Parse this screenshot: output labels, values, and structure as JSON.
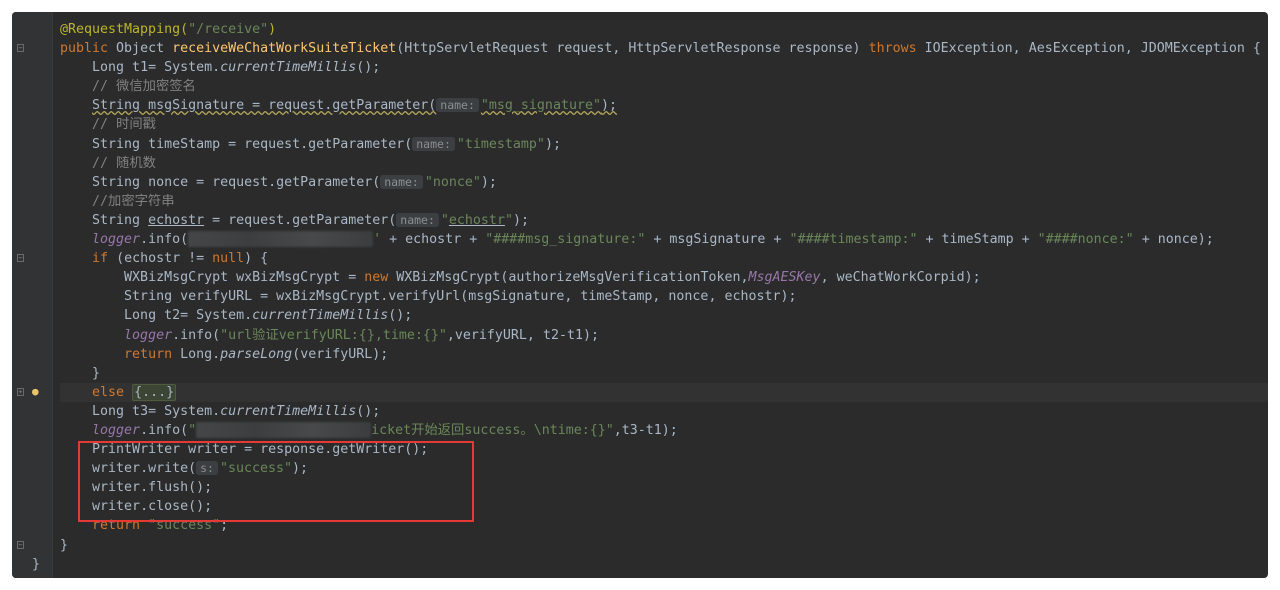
{
  "colors": {
    "background": "#2b2b2b",
    "keyword": "#cc7832",
    "string": "#6a8759",
    "annotation": "#bbb529",
    "method": "#ffc66d",
    "comment": "#808080",
    "highlight_box": "#e53935"
  },
  "gutter": {
    "icons": [
      "fold-icon",
      "fold-icon",
      "lightbulb-icon",
      "fold-icon"
    ]
  },
  "code": {
    "l1": [
      "@RequestMapping(",
      "\"/receive\"",
      ")"
    ],
    "l2": [
      "public ",
      "Object ",
      "receiveWeChatWorkSuiteTicket",
      "(HttpServletRequest request, HttpServletResponse response) ",
      "throws ",
      "IOException, AesException, JDOMException {"
    ],
    "l3": [
      "Long t1= System.",
      "currentTimeMillis",
      "();"
    ],
    "l4": [
      "// 微信加密签名"
    ],
    "l5": [
      "String msgSignature = request.getParameter(",
      "name:",
      "\"msg_signature\"",
      ");"
    ],
    "l6": [
      "// 时间戳"
    ],
    "l7": [
      "String timeStamp = request.getParameter(",
      "name:",
      "\"timestamp\"",
      ");"
    ],
    "l8": [
      "// 随机数"
    ],
    "l9": [
      "String nonce = request.getParameter(",
      "name:",
      "\"nonce\"",
      ");"
    ],
    "l10": [
      "//加密字符串"
    ],
    "l11": [
      "String ",
      "echostr",
      " = request.getParameter(",
      "name:",
      "\"",
      "echostr",
      "\"",
      ");"
    ],
    "l12": [
      "logger",
      ".info(",
      "'",
      " + echostr + ",
      "\"####msg_signature:\"",
      " + msgSignature + ",
      "\"####timestamp:\"",
      " + timeStamp + ",
      "\"####nonce:\"",
      " + nonce);"
    ],
    "l13": [
      "if ",
      "(echostr != ",
      "null",
      ") {"
    ],
    "l14": [
      "WXBizMsgCrypt wxBizMsgCrypt = ",
      "new ",
      "WXBizMsgCrypt(authorizeMsgVerificationToken,",
      "MsgAESKey",
      ", weChatWorkCorpid);"
    ],
    "l15": [
      "String verifyURL = wxBizMsgCrypt.verifyUrl(msgSignature, timeStamp, nonce, echostr);"
    ],
    "l16": [
      "Long t2= System.",
      "currentTimeMillis",
      "();"
    ],
    "l17": [
      "logger",
      ".info(",
      "\"url验证verifyURL:{},time:{}\"",
      ",verifyURL, t2-t1);"
    ],
    "l18": [
      "return ",
      "Long.",
      "parseLong",
      "(verifyURL);"
    ],
    "l19": [
      "}"
    ],
    "l20": [
      "else ",
      "{...}"
    ],
    "l21": [
      "Long t3= System.",
      "currentTimeMillis",
      "();"
    ],
    "l22": [
      "logger",
      ".info(",
      "\"",
      "icket开始返回success。\\ntime:{}\"",
      ",t3-t1);"
    ],
    "l23": [
      "PrintWriter writer = response.getWriter();"
    ],
    "l24": [
      "writer.write(",
      "s:",
      "\"success\"",
      ");"
    ],
    "l25": [
      "writer.flush();"
    ],
    "l26": [
      "writer.close();"
    ],
    "l27": [
      "return ",
      "\"success\"",
      ";"
    ],
    "l28": [
      "}"
    ],
    "l29": [
      "}"
    ]
  }
}
